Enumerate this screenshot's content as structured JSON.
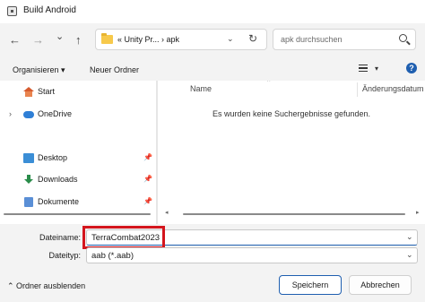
{
  "window": {
    "title": "Build Android"
  },
  "nav": {
    "back": "←",
    "forward": "→",
    "history": "⌄",
    "up": "↑",
    "address": {
      "path_text": "« Unity Pr...  ›  apk",
      "dropdown": "⌄",
      "refresh": "↻"
    },
    "search": {
      "placeholder": "apk durchsuchen"
    }
  },
  "toolbar": {
    "organize": "Organisieren ▾",
    "new_folder": "Neuer Ordner",
    "view_chevron": "▾",
    "help": "?"
  },
  "sidebar": {
    "items": [
      {
        "label": "Start",
        "icon": "home-icon"
      },
      {
        "label": "OneDrive",
        "icon": "cloud-icon",
        "expand": "›"
      },
      {
        "label": "Desktop",
        "icon": "desktop-folder-icon",
        "pin": "📌"
      },
      {
        "label": "Downloads",
        "icon": "downloads-icon",
        "pin": "📌"
      },
      {
        "label": "Dokumente",
        "icon": "documents-icon",
        "pin": "📌"
      }
    ]
  },
  "filelist": {
    "columns": [
      "Name",
      "Änderungsdatum"
    ],
    "sort_indicator": "^",
    "empty_message": "Es wurden keine Suchergebnisse gefunden."
  },
  "form": {
    "filename_label": "Dateiname:",
    "filename_value": "TerraCombat2023",
    "filetype_label": "Dateityp:",
    "filetype_value": "aab (*.aab)",
    "dropdown_chevron": "⌄"
  },
  "footer": {
    "hide_folders": "⌃  Ordner ausblenden",
    "save": "Speichern",
    "cancel": "Abbrechen"
  },
  "colors": {
    "highlight_box": "#d4151d",
    "accent": "#1f5fb0"
  }
}
